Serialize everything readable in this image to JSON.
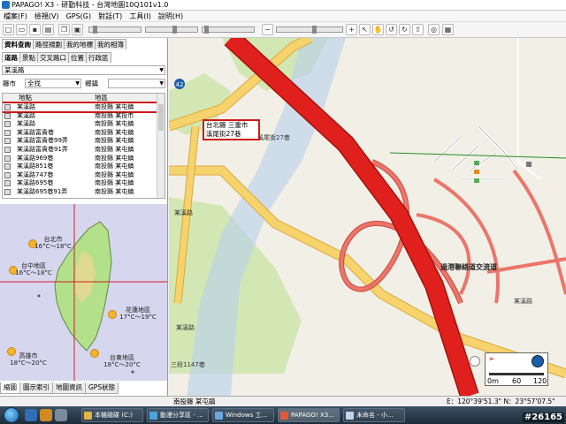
{
  "window": {
    "title": "PAPAGO! X3 - 研勤科技 - 台灣地圖10Q101v1.0"
  },
  "menu": [
    "檔案(F)",
    "檢視(V)",
    "GPS(G)",
    "對話(T)",
    "工具(I)",
    "說明(H)"
  ],
  "toolbar": {
    "icons": [
      "new-icon",
      "open-icon",
      "save-icon",
      "print-icon",
      "copy-icon",
      "paste-icon",
      "zoom-out-icon",
      "zoom-in-icon",
      "pointer-icon",
      "hand-icon",
      "rotate-left-icon",
      "rotate-right-icon",
      "gps-icon",
      "layer-icon"
    ]
  },
  "left_panel": {
    "tabs_row1": [
      "資料查詢",
      "路徑規劃",
      "我的地標",
      "我的相簿"
    ],
    "tabs_row2": [
      "道路",
      "景點",
      "交叉路口",
      "位置",
      "行政區"
    ],
    "road_label": "某溪路",
    "county_label": "縣市",
    "county_value": "全找",
    "town_label": "鄉鎮",
    "town_value": "",
    "results": {
      "columns": [
        "地點",
        "地區"
      ],
      "rows": [
        {
          "name": "某溪路",
          "area": "南投縣 某屯鎮",
          "selected": true
        },
        {
          "name": "某溪路",
          "area": "南投縣 某投市",
          "selected": false
        },
        {
          "name": "某溪路",
          "area": "南投縣 某屯鎮",
          "selected": false
        },
        {
          "name": "某溪路富貴巷",
          "area": "南投縣 某屯鎮",
          "selected": false
        },
        {
          "name": "某溪路富貴巷99弄",
          "area": "南投縣 某屯鎮",
          "selected": false
        },
        {
          "name": "某溪路富貴巷91弄",
          "area": "南投縣 某屯鎮",
          "selected": false
        },
        {
          "name": "某溪路969巷",
          "area": "南投縣 某屯鎮",
          "selected": false
        },
        {
          "name": "某溪路851巷",
          "area": "南投縣 某屯鎮",
          "selected": false
        },
        {
          "name": "某溪路747巷",
          "area": "南投縣 某屯鎮",
          "selected": false
        },
        {
          "name": "某溪路695巷",
          "area": "南投縣 某屯鎮",
          "selected": false
        },
        {
          "name": "某溪路695巷91弄",
          "area": "南投縣 某屯鎮",
          "selected": false
        }
      ]
    },
    "weather": [
      {
        "city": "台北市",
        "temp": "16°C～18°C"
      },
      {
        "city": "台中地區",
        "temp": "16°C～18°C"
      },
      {
        "city": "花蓮地區",
        "temp": "17°C～19°C"
      },
      {
        "city": "高雄市",
        "temp": "18°C～20°C"
      },
      {
        "city": "台東地區",
        "temp": "18°C～20°C"
      }
    ],
    "bottom_tabs": [
      "縮圖",
      "圖示索引",
      "地圖資訊",
      "GPS狀態"
    ]
  },
  "map": {
    "callout": [
      "台北縣 三重市",
      "溪尾街27巷"
    ],
    "labels": {
      "street1": "溪尾街27巷",
      "shield": "42",
      "exit_label": "過港聯絡道交流道",
      "road_small_1": "某溪路",
      "road_small_2": "某溪路",
      "road_small_3": "三段1147巷",
      "road_right": "某溪路"
    },
    "scale": {
      "ticks": [
        "0m",
        "60",
        "120"
      ]
    }
  },
  "status": {
    "district": "南投縣 某屯鎮",
    "coords": "E：120°39'51.3\"  N：23°57'07.5\""
  },
  "taskbar": {
    "tasks": [
      "本機磁碟 (C:)",
      "動漫分享區 - ...",
      "Windows 工...",
      "PAPAGO! X3...",
      "未命名 - 小..."
    ],
    "watermark": "#26165"
  },
  "colors": {
    "freeway": "#e0201c",
    "ramp": "#ec7569",
    "arterial": "#f6d36c",
    "map_bg": "#f2efe6",
    "river": "#b8d0ee",
    "park": "#d3e7b4"
  }
}
